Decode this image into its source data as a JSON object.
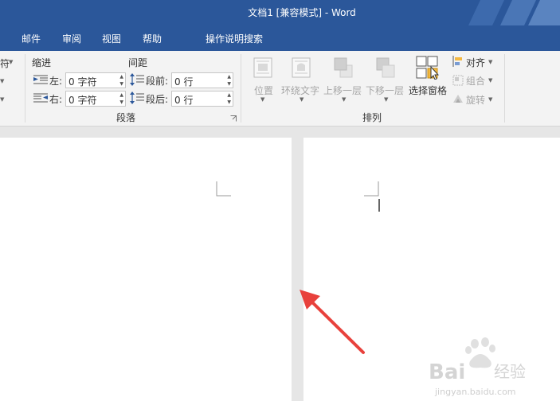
{
  "window": {
    "title": "文档1 [兼容模式]  -  Word"
  },
  "tabs": [
    "邮件",
    "审阅",
    "视图",
    "帮助"
  ],
  "tell_me": "操作说明搜索",
  "ribbon": {
    "partial_left_label": "符",
    "indent": {
      "header": "缩进",
      "left_label": "左:",
      "left_value": "0 字符",
      "right_label": "右:",
      "right_value": "0 字符"
    },
    "spacing": {
      "header": "间距",
      "before_label": "段前:",
      "before_value": "0 行",
      "after_label": "段后:",
      "after_value": "0 行"
    },
    "paragraph_group_label": "段落",
    "arrange": {
      "position": "位置",
      "wrap_text": "环绕文字",
      "bring_forward": "上移一层",
      "send_backward": "下移一层",
      "selection_pane": "选择窗格",
      "align": "对齐",
      "group": "组合",
      "rotate": "旋转",
      "group_label": "排列"
    }
  },
  "watermark": {
    "logo": "Baidu经验",
    "url": "jingyan.baidu.com"
  },
  "colors": {
    "title_bar": "#2b579a",
    "ribbon_bg": "#f3f3f3",
    "doc_bg": "#e6e6e6",
    "arrow": "#e8413c"
  }
}
